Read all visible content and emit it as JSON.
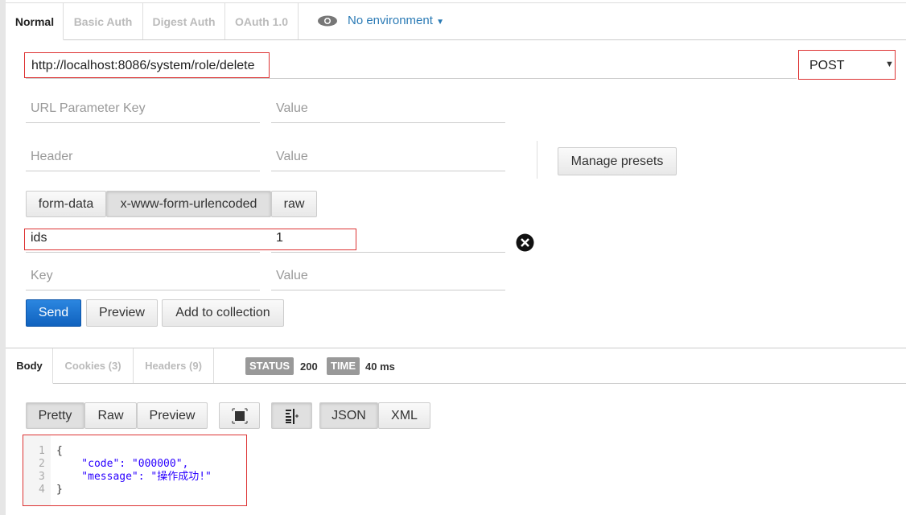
{
  "auth_tabs": [
    "Normal",
    "Basic Auth",
    "Digest Auth",
    "OAuth 1.0"
  ],
  "environment": "No environment",
  "url": "http://localhost:8086/system/role/delete",
  "method": "POST",
  "url_params": {
    "key_placeholder": "URL Parameter Key",
    "value_placeholder": "Value"
  },
  "headers": {
    "key_placeholder": "Header",
    "value_placeholder": "Value"
  },
  "manage_presets": "Manage presets",
  "body_modes": [
    "form-data",
    "x-www-form-urlencoded",
    "raw"
  ],
  "body_params": [
    {
      "key": "ids",
      "value": "1"
    }
  ],
  "new_param": {
    "key_placeholder": "Key",
    "value_placeholder": "Value"
  },
  "actions": {
    "send": "Send",
    "preview": "Preview",
    "add": "Add to collection"
  },
  "response_tabs": [
    "Body",
    "Cookies (3)",
    "Headers (9)"
  ],
  "status": {
    "label": "STATUS",
    "value": "200"
  },
  "time": {
    "label": "TIME",
    "value": "40 ms"
  },
  "view_modes": [
    "Pretty",
    "Raw",
    "Preview"
  ],
  "formats": [
    "JSON",
    "XML"
  ],
  "response_lines": [
    "{",
    "    \"code\": \"000000\",",
    "    \"message\": \"操作成功!\"",
    "}"
  ],
  "colors": {
    "send": "#1a6fcc",
    "highlight": "#dd3333",
    "json_string": "#2a00ff"
  }
}
